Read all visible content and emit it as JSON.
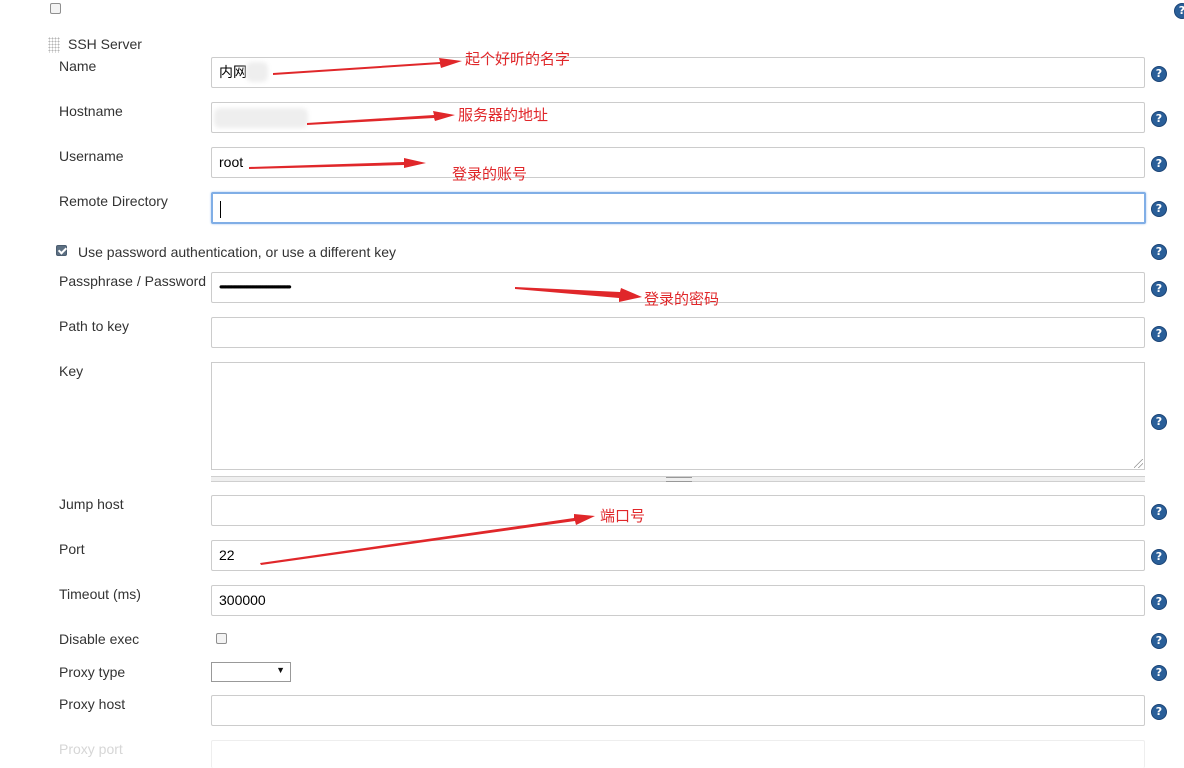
{
  "top": {
    "checkbox_checked": false
  },
  "ssh_server": {
    "title": "SSH Server"
  },
  "fields": {
    "name": {
      "label": "Name",
      "value": "内网"
    },
    "hostname": {
      "label": "Hostname",
      "value": ""
    },
    "username": {
      "label": "Username",
      "value": "root"
    },
    "remote_directory": {
      "label": "Remote Directory",
      "value": ""
    },
    "use_password": {
      "label": "Use password authentication, or use a different key",
      "checked": true
    },
    "passphrase": {
      "label": "Passphrase / Password",
      "value": "••••••••••••••••••••••••••••••••••••••••••••••••••••••••••"
    },
    "path_to_key": {
      "label": "Path to key",
      "value": ""
    },
    "key": {
      "label": "Key",
      "value": ""
    },
    "jump_host": {
      "label": "Jump host",
      "value": ""
    },
    "port": {
      "label": "Port",
      "value": "22"
    },
    "timeout": {
      "label": "Timeout (ms)",
      "value": "300000"
    },
    "disable_exec": {
      "label": "Disable exec",
      "checked": false
    },
    "proxy_type": {
      "label": "Proxy type",
      "value": ""
    },
    "proxy_host": {
      "label": "Proxy host",
      "value": ""
    },
    "proxy_port": {
      "label": "Proxy port",
      "value": ""
    }
  },
  "help_icon_glyph": "?",
  "annotations": {
    "name_note": "起个好听的名字",
    "hostname_note": "服务器的地址",
    "username_note": "登录的账号",
    "password_note": "登录的密码",
    "port_note": "端口号"
  },
  "colors": {
    "annotation": "#e0272a",
    "help_icon": "#2a5f99",
    "focus_border": "#80aee6"
  }
}
